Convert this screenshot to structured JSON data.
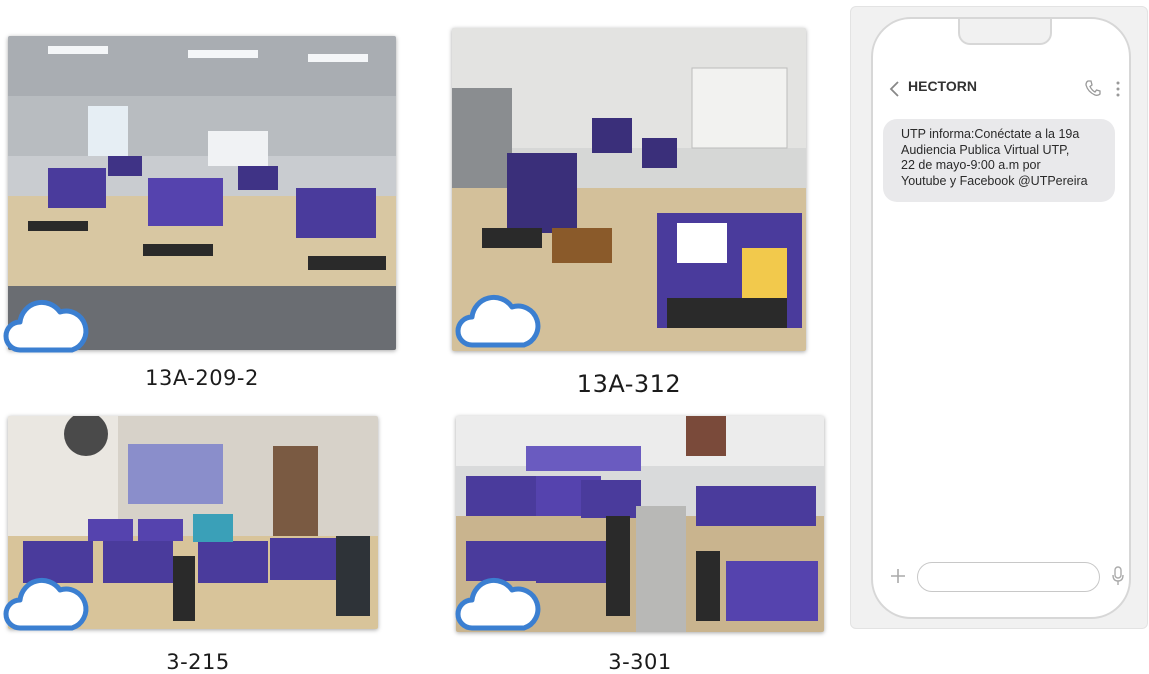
{
  "rooms": [
    {
      "id": "r1",
      "label": "13A-209-2"
    },
    {
      "id": "r2",
      "label": "13A-312"
    },
    {
      "id": "r3",
      "label": "3-215"
    },
    {
      "id": "r4",
      "label": "3-301"
    }
  ],
  "badge_icon": "cloud-icon",
  "colors": {
    "cloud_stroke": "#3b7fd1",
    "bubble_bg": "#e9e9eb",
    "screen_purple": "#4a3b9c",
    "desk_wood": "#d8c7a2"
  },
  "phone": {
    "contact_name": "HECTORN",
    "icons": {
      "back": "chevron-left-icon",
      "call": "phone-icon",
      "more": "more-vertical-icon",
      "attach": "plus-icon",
      "voice": "microphone-icon"
    },
    "message_lines": [
      "UTP informa:Conéctate a la 19a",
      "Audiencia Publica Virtual UTP,",
      "22 de mayo-9:00 a.m por",
      "Youtube y Facebook @UTPereira"
    ],
    "input_value": "",
    "input_placeholder": ""
  }
}
